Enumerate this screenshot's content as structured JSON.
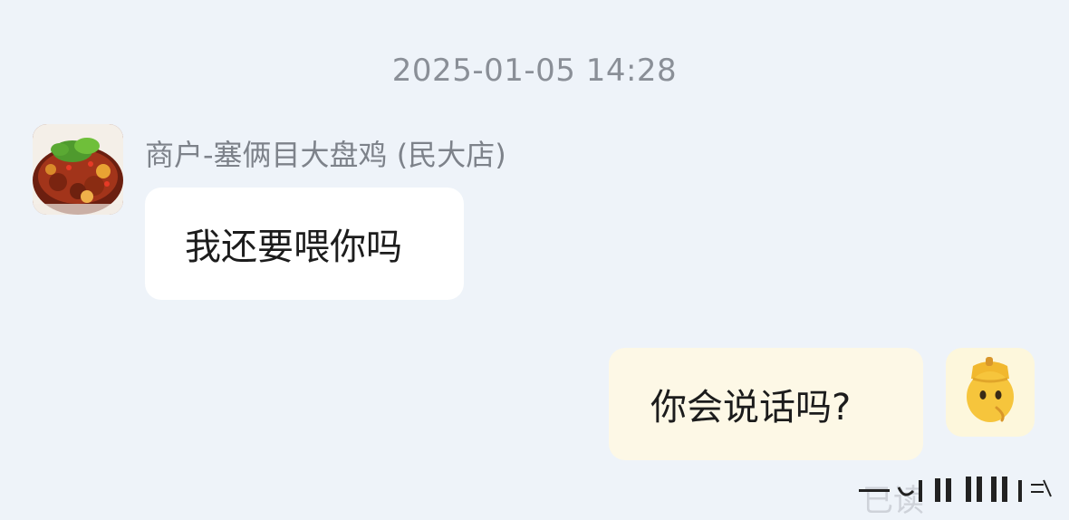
{
  "timestamp": "2025-01-05 14:28",
  "merchant": {
    "name": "商户-塞俩目大盘鸡 (民大店)",
    "avatar_icon": "dish-photo-icon"
  },
  "messages": {
    "incoming_text": "我还要喂你吗",
    "outgoing_text": "你会说话吗?"
  },
  "user": {
    "avatar_icon": "acorn-mascot-icon"
  },
  "status": {
    "read_label": "已读"
  },
  "colors": {
    "page_bg": "#eef3f9",
    "incoming_bubble": "#ffffff",
    "outgoing_bubble": "#fdf8e6",
    "mascot": "#f6c53c"
  }
}
